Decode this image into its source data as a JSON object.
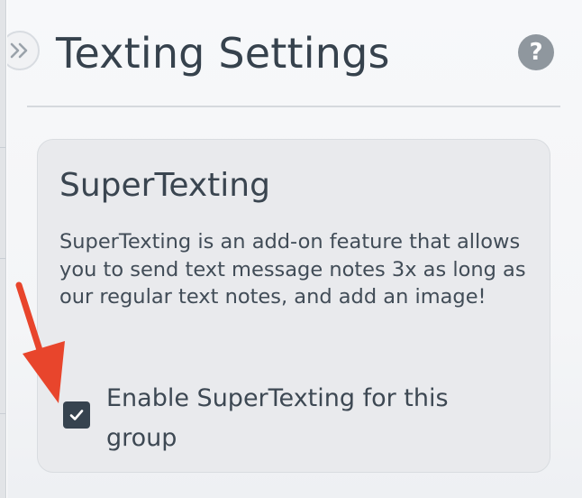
{
  "panel": {
    "title": "Texting Settings",
    "help_icon_glyph": "?",
    "collapse_icon": "double-chevron-right-icon"
  },
  "card": {
    "title": "SuperTexting",
    "description": "SuperTexting is an add-on feature that allows you to send text message notes 3x as long as our regular text notes, and add an image!",
    "checkbox": {
      "label": "Enable SuperTexting for this group",
      "checked": true
    }
  },
  "annotation": {
    "icon": "red-arrow-icon",
    "color": "#e8452c"
  },
  "colors": {
    "title_text": "#36424d",
    "checkbox_fill": "#36434f",
    "help_icon": "#8f979e",
    "card_background": "#e9eaed"
  }
}
